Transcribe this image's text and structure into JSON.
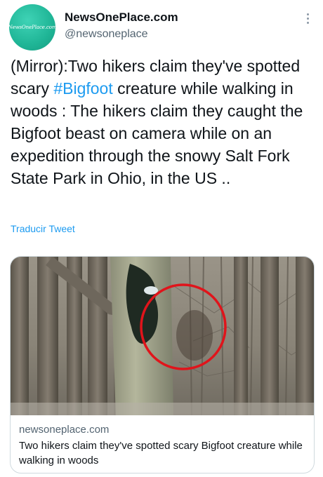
{
  "author": {
    "display_name": "NewsOnePlace.com",
    "handle": "@newsoneplace",
    "avatar_text": "NewsOnePlace.com"
  },
  "tweet": {
    "text_before": "(Mirror):Two hikers claim they've spotted scary ",
    "hashtag": "#Bigfoot",
    "text_after": " creature while walking in woods : The hikers claim they caught the Bigfoot beast on camera while on an expedition through the snowy Salt Fork State Park in Ohio, in the US .."
  },
  "translate_label": "Traducir Tweet",
  "card": {
    "domain": "newsoneplace.com",
    "title": "Two hikers claim they've spotted scary Bigfoot creature while walking in woods"
  },
  "icons": {
    "more": "more-vertical-icon",
    "annotation": "red-circle-annotation"
  },
  "colors": {
    "link": "#1d9bf0",
    "text": "#0f1419",
    "secondary": "#536471",
    "avatar": "#1fb596",
    "annotation": "#e0141b"
  }
}
